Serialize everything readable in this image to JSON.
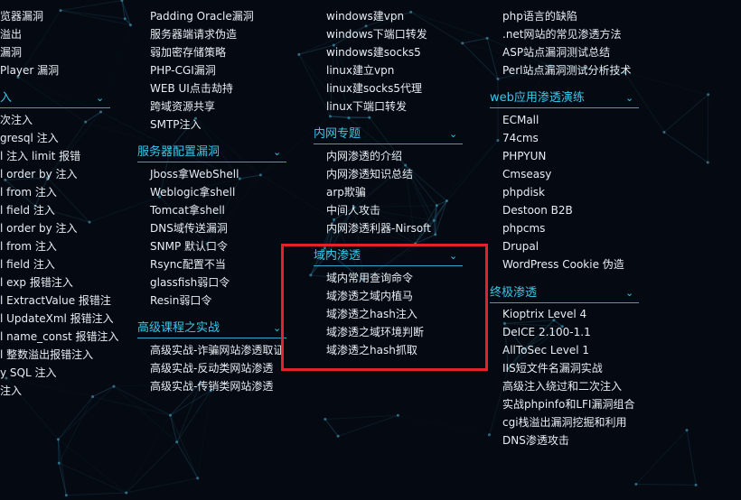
{
  "col1": {
    "items_top": [
      "览器漏洞",
      "溢出",
      "漏洞",
      "Player 漏洞"
    ],
    "section": {
      "title": "入",
      "chevron_icon": "chevron-down-icon"
    },
    "items": [
      "次注入",
      "gresql 注入",
      "l 注入 limit 报错",
      "l order by 注入",
      "l from 注入",
      "l field 注入",
      "l order by 注入",
      "l from 注入",
      "l field 注入",
      "l exp 报错注入",
      "l ExtractValue 报错注",
      "l UpdateXml 报错注入",
      "l name_const 报错注入",
      "l 整数溢出报错注入",
      "y SQL 注入",
      "注入"
    ]
  },
  "col2": {
    "items_top": [
      "Padding Oracle漏洞",
      "服务器端请求伪造",
      "弱加密存储策略",
      "PHP-CGI漏洞",
      "WEB UI点击劫持",
      "跨域资源共享",
      "SMTP注入"
    ],
    "section1": {
      "title": "服务器配置漏洞"
    },
    "items1": [
      "Jboss拿WebShell",
      "Weblogic拿shell",
      "Tomcat拿shell",
      "DNS域传送漏洞",
      "SNMP 默认口令",
      "Rsync配置不当",
      "glassfish弱口令",
      "Resin弱口令"
    ],
    "section2": {
      "title": "高级课程之实战"
    },
    "items2": [
      "高级实战-诈骗网站渗透取证",
      "高级实战-反动类网站渗透",
      "高级实战-传销类网站渗透"
    ]
  },
  "col3": {
    "items_top": [
      "windows建vpn",
      "windows下端口转发",
      "windows建socks5",
      "linux建立vpn",
      "linux建socks5代理",
      "linux下端口转发"
    ],
    "section1": {
      "title": "内网专题"
    },
    "items1": [
      "内网渗透的介绍",
      "内网渗透知识总结",
      "arp欺骗",
      "中间人攻击",
      "内网渗透利器-Nirsoft"
    ],
    "section2": {
      "title": "域内渗透"
    },
    "items2": [
      "域内常用查询命令",
      "域渗透之域内植马",
      "域渗透之hash注入",
      "域渗透之域环境判断",
      "域渗透之hash抓取"
    ]
  },
  "col4": {
    "items_top": [
      "php语言的缺陷",
      ".net网站的常见渗透方法",
      "ASP站点漏洞测试总结",
      "Perl站点漏洞测试分析技术"
    ],
    "section1": {
      "title": "web应用渗透演练"
    },
    "items1": [
      "ECMall",
      "74cms",
      "PHPYUN",
      "Cmseasy",
      "phpdisk",
      "Destoon B2B",
      "phpcms",
      "Drupal",
      "WordPress Cookie 伪造"
    ],
    "section2": {
      "title": "终极渗透"
    },
    "items2": [
      "Kioptrix Level 4",
      "DeICE 2.100-1.1",
      "AllToSec Level 1",
      "IIS短文件名漏洞实战",
      "高级注入绕过和二次注入",
      "实战phpinfo和LFI漏洞组合",
      "cgi栈溢出漏洞挖掘和利用",
      "DNS渗透攻击"
    ]
  },
  "colors": {
    "background": "#050a12",
    "accent": "#36c8e8",
    "highlight_box": "#e4222b",
    "text": "#e8edf2"
  }
}
